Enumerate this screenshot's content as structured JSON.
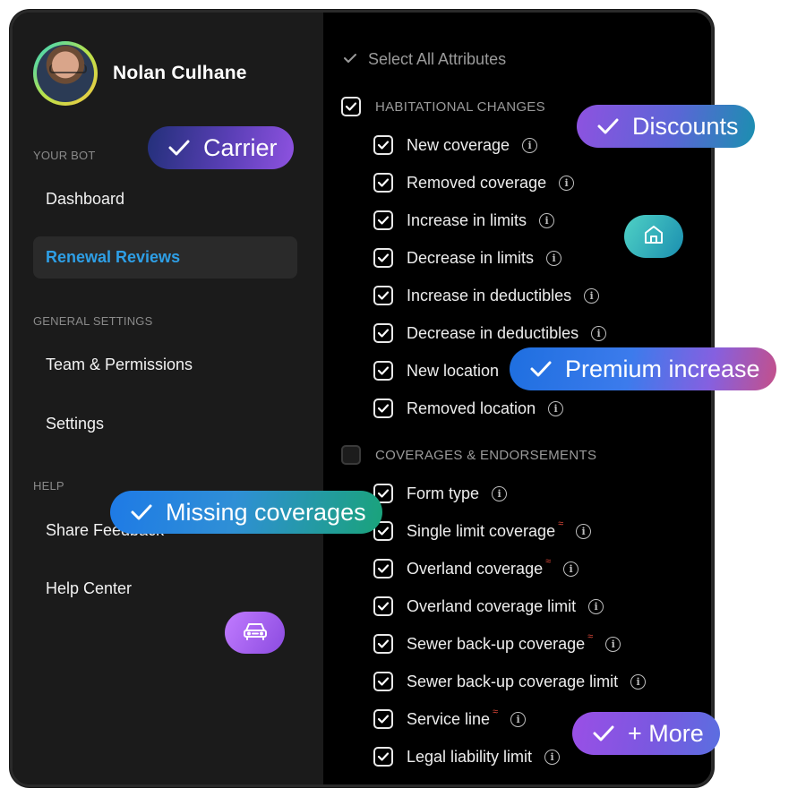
{
  "user": {
    "name": "Nolan Culhane"
  },
  "sidebar": {
    "sections": {
      "your_bot": "YOUR BOT",
      "general_settings": "GENERAL SETTINGS",
      "help": "HELP"
    },
    "items": {
      "dashboard": "Dashboard",
      "renewal_reviews": "Renewal Reviews",
      "team_permissions": "Team & Permissions",
      "settings": "Settings",
      "share_feedback": "Share Feedback",
      "help_center": "Help Center"
    }
  },
  "main": {
    "select_all": "Select All Attributes",
    "groups": [
      {
        "title": "HABITATIONAL CHANGES",
        "checked": true,
        "items": [
          {
            "label": "New coverage",
            "checked": true,
            "flag": false
          },
          {
            "label": "Removed coverage",
            "checked": true,
            "flag": false
          },
          {
            "label": "Increase in limits",
            "checked": true,
            "flag": false
          },
          {
            "label": "Decrease in limits",
            "checked": true,
            "flag": false
          },
          {
            "label": "Increase in deductibles",
            "checked": true,
            "flag": false
          },
          {
            "label": "Decrease in deductibles",
            "checked": true,
            "flag": false
          },
          {
            "label": "New location",
            "checked": true,
            "flag": false
          },
          {
            "label": "Removed location",
            "checked": true,
            "flag": false
          }
        ]
      },
      {
        "title": "COVERAGES & ENDORSEMENTS",
        "checked": false,
        "items": [
          {
            "label": "Form type",
            "checked": true,
            "flag": false
          },
          {
            "label": "Single limit coverage",
            "checked": true,
            "flag": true
          },
          {
            "label": "Overland coverage",
            "checked": true,
            "flag": true
          },
          {
            "label": "Overland coverage limit",
            "checked": true,
            "flag": false
          },
          {
            "label": "Sewer back-up coverage",
            "checked": true,
            "flag": true
          },
          {
            "label": "Sewer back-up coverage limit",
            "checked": true,
            "flag": false
          },
          {
            "label": "Service line",
            "checked": true,
            "flag": true
          },
          {
            "label": "Legal liability limit",
            "checked": true,
            "flag": false
          }
        ]
      }
    ]
  },
  "chips": {
    "carrier": "Carrier",
    "discounts": "Discounts",
    "premium_increase": "Premium increase",
    "missing_coverages": "Missing coverages",
    "more": "+ More"
  },
  "icons": {
    "home_chip": "home-icon",
    "car_chip": "car-icon",
    "check": "check-icon",
    "info": "info-icon"
  },
  "colors": {
    "active_nav": "#2e9fe6",
    "flag": "#e64b3c"
  }
}
